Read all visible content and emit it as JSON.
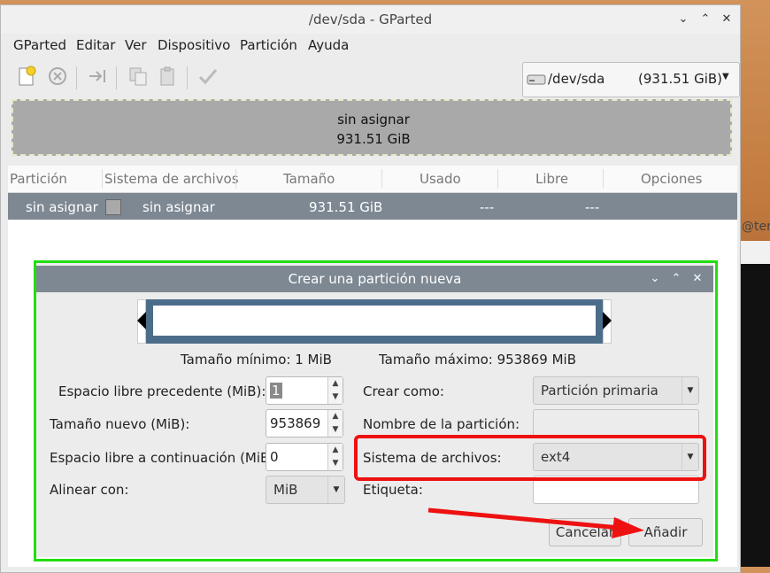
{
  "window": {
    "title": "/dev/sda - GParted",
    "min_icon": "chevron-down-icon",
    "max_icon": "chevron-up-icon",
    "close_icon": "close-icon"
  },
  "menu": [
    "GParted",
    "Editar",
    "Ver",
    "Dispositivo",
    "Partición",
    "Ayuda"
  ],
  "toolbar": {
    "device": "/dev/sda",
    "device_size": "(931.51 GiB)"
  },
  "graph": {
    "label": "sin asignar",
    "size": "931.51 GiB"
  },
  "table": {
    "headers": [
      "Partición",
      "Sistema de archivos",
      "Tamaño",
      "Usado",
      "Libre",
      "Opciones"
    ],
    "row": {
      "partition": "sin asignar",
      "filesystem": "sin asignar",
      "size": "931.51 GiB",
      "used": "---",
      "free": "---"
    }
  },
  "background": {
    "terminal_fragment": "@ter"
  },
  "dialog": {
    "title": "Crear una partición nueva",
    "min_size": "Tamaño mínimo: 1 MiB",
    "max_size": "Tamaño máximo: 953869 MiB",
    "free_before_label": "Espacio libre precedente (MiB):",
    "free_before_value": "1",
    "new_size_label": "Tamaño nuevo (MiB):",
    "new_size_value": "953869",
    "free_after_label": "Espacio libre a continuación (MiB):",
    "free_after_value": "0",
    "align_label": "Alinear con:",
    "align_value": "MiB",
    "create_as_label": "Crear como:",
    "create_as_value": "Partición primaria",
    "partition_name_label": "Nombre de la partición:",
    "filesystem_label": "Sistema de archivos:",
    "filesystem_value": "ext4",
    "label_label": "Etiqueta:",
    "cancel": "Cancelar",
    "add": "Añadir"
  },
  "annotation_colors": {
    "green_frame": "#22dd11",
    "red_box": "#ee1111",
    "red_arrow": "#ee1111"
  }
}
